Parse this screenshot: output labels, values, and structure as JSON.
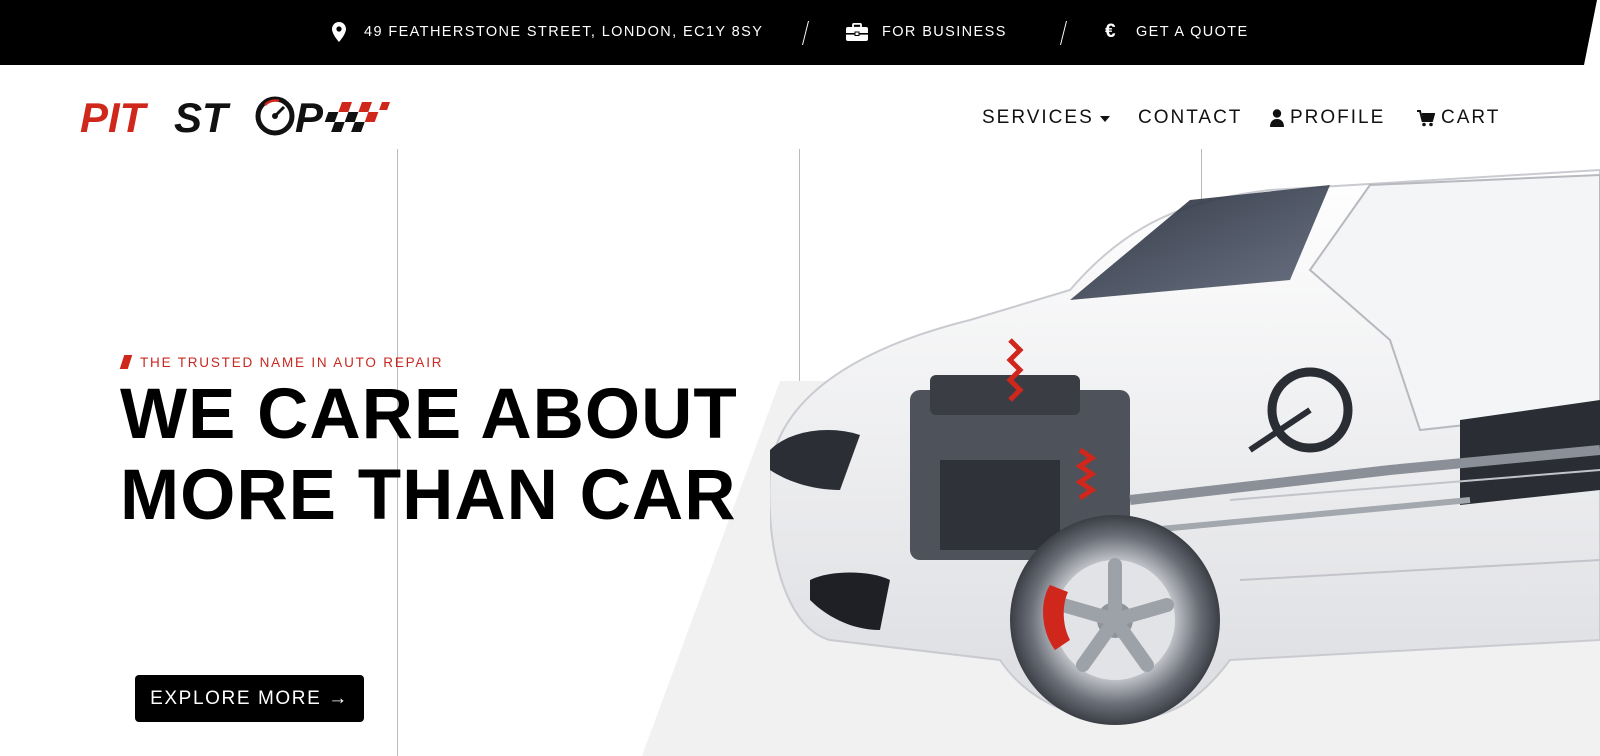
{
  "topbar": {
    "address": "49 FEATHERSTONE STREET, LONDON, EC1Y 8SY",
    "business": "FOR BUSINESS",
    "quote": "GET A QUOTE"
  },
  "brand": {
    "logo_text_red": "PIT",
    "logo_text_black": "ST",
    "logo_text_black2": "P",
    "accent_color": "#d0271d"
  },
  "nav": {
    "services": "SERVICES",
    "contact": "CONTACT",
    "profile": "PROFILE",
    "cart": "CART"
  },
  "hero": {
    "tagline": "THE TRUSTED NAME IN AUTO REPAIR",
    "headline_line1": "WE CARE ABOUT",
    "headline_line2": "MORE THAN CAR",
    "cta": "EXPLORE MORE →"
  },
  "icons": {
    "address": "map-pin-icon",
    "business": "briefcase-icon",
    "quote": "euro-icon",
    "services": "caret-down-icon",
    "profile": "user-icon",
    "cart": "cart-icon"
  }
}
